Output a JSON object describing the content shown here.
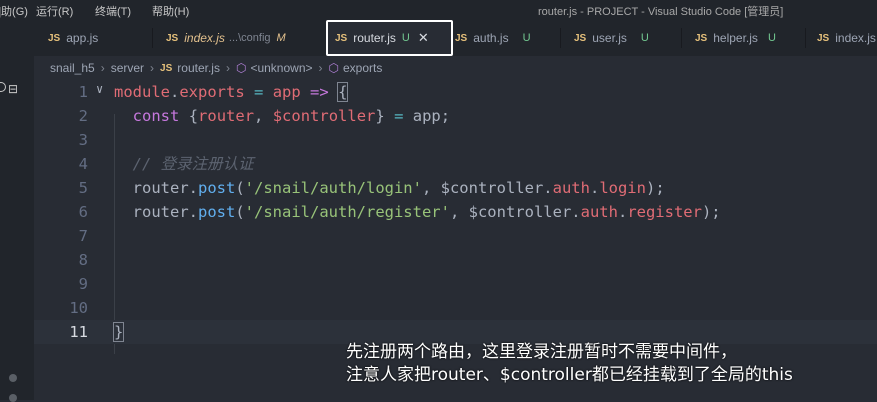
{
  "titlebar": {
    "menu_items": [
      "]助(G)",
      "运行(R)",
      "终端(T)",
      "帮助(H)"
    ],
    "window_title": "router.js - PROJECT - Visual Studio Code [管理员]"
  },
  "tabs": [
    {
      "icon_label": "JS",
      "name": "app.js"
    },
    {
      "icon_label": "JS",
      "name": "index.js",
      "path": "...\\config",
      "status": "M"
    },
    {
      "icon_label": "JS",
      "name": "router.js",
      "status": "U",
      "active": true
    },
    {
      "icon_label": "JS",
      "name": "auth.js",
      "status": "U"
    },
    {
      "icon_label": "JS",
      "name": "user.js",
      "status": "U"
    },
    {
      "icon_label": "JS",
      "name": "helper.js",
      "status": "U"
    },
    {
      "icon_label": "JS",
      "name": "index.js"
    }
  ],
  "breadcrumb": [
    "snail_h5",
    "server",
    "router.js",
    "<unknown>",
    "exports"
  ],
  "breadcrumb_file_icon": "JS",
  "editor": {
    "line_numbers": [
      "1",
      "2",
      "3",
      "4",
      "5",
      "6",
      "7",
      "8",
      "9",
      "10",
      "11"
    ],
    "current_line": "11",
    "lines": [
      "module.exports = app => {",
      "  const {router, $controller} = app;",
      "",
      "  // 登录注册认证",
      "  router.post('/snail/auth/login', $controller.auth.login);",
      "  router.post('/snail/auth/register', $controller.auth.register);",
      "",
      "",
      "",
      "",
      "}"
    ]
  },
  "subtitle": {
    "line1": "先注册两个路由，这里登录注册暂时不需要中间件，",
    "line2": "注意人家把router、$controller都已经挂载到了全局的this"
  },
  "icons": {
    "activity": [
      "ellipsis-icon",
      "collapse-icon"
    ],
    "close": "close-icon"
  }
}
